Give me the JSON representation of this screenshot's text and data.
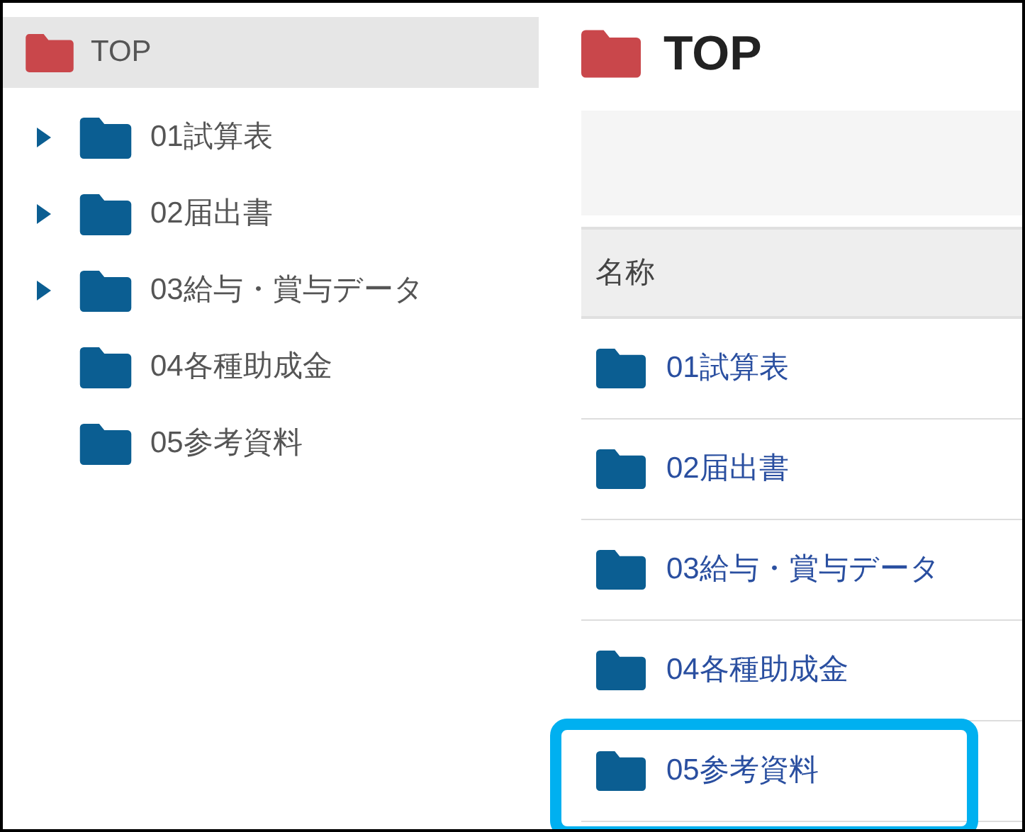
{
  "tree": {
    "root": {
      "label": "TOP",
      "selected": true
    },
    "items": [
      {
        "label": "01試算表",
        "expandable": true
      },
      {
        "label": "02届出書",
        "expandable": true
      },
      {
        "label": "03給与・賞与データ",
        "expandable": true
      },
      {
        "label": "04各種助成金",
        "expandable": false
      },
      {
        "label": "05参考資料",
        "expandable": false
      }
    ]
  },
  "content": {
    "title": "TOP",
    "table": {
      "columns": [
        "名称"
      ],
      "rows": [
        {
          "name": "01試算表",
          "highlighted": false
        },
        {
          "name": "02届出書",
          "highlighted": false
        },
        {
          "name": "03給与・賞与データ",
          "highlighted": false
        },
        {
          "name": "04各種助成金",
          "highlighted": false
        },
        {
          "name": "05参考資料",
          "highlighted": true
        }
      ]
    }
  }
}
